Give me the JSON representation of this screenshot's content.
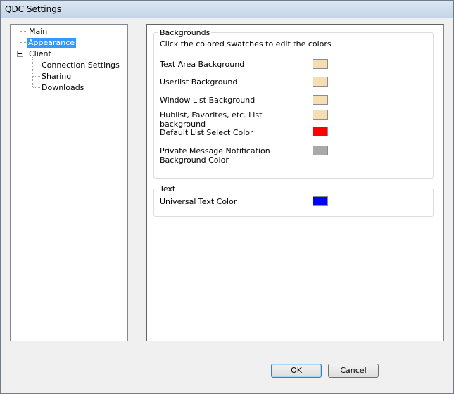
{
  "window": {
    "title": "QDC Settings"
  },
  "tree": {
    "items": [
      {
        "label": "Main"
      },
      {
        "label": "Appearance",
        "selected": true
      },
      {
        "label": "Client",
        "expanded": true
      },
      {
        "label": "Connection Settings"
      },
      {
        "label": "Sharing"
      },
      {
        "label": "Downloads"
      }
    ]
  },
  "backgrounds": {
    "title": "Backgrounds",
    "hint": "Click the colored swatches to edit the colors",
    "rows": [
      {
        "label": "Text Area Background",
        "color": "#f5deb3"
      },
      {
        "label": "Userlist Background",
        "color": "#f5deb3"
      },
      {
        "label": "Window List Background",
        "color": "#f5deb3"
      },
      {
        "label": "Hublist, Favorites, etc. List background",
        "color": "#f5deb3"
      },
      {
        "label": "Default List Select Color",
        "color": "#ff0000"
      },
      {
        "label": "Private Message Notification Background Color",
        "color": "#a9a9a9"
      }
    ]
  },
  "text": {
    "title": "Text",
    "rows": [
      {
        "label": "Universal Text Color",
        "color": "#0000ff"
      }
    ]
  },
  "buttons": {
    "ok": "OK",
    "cancel": "Cancel"
  }
}
